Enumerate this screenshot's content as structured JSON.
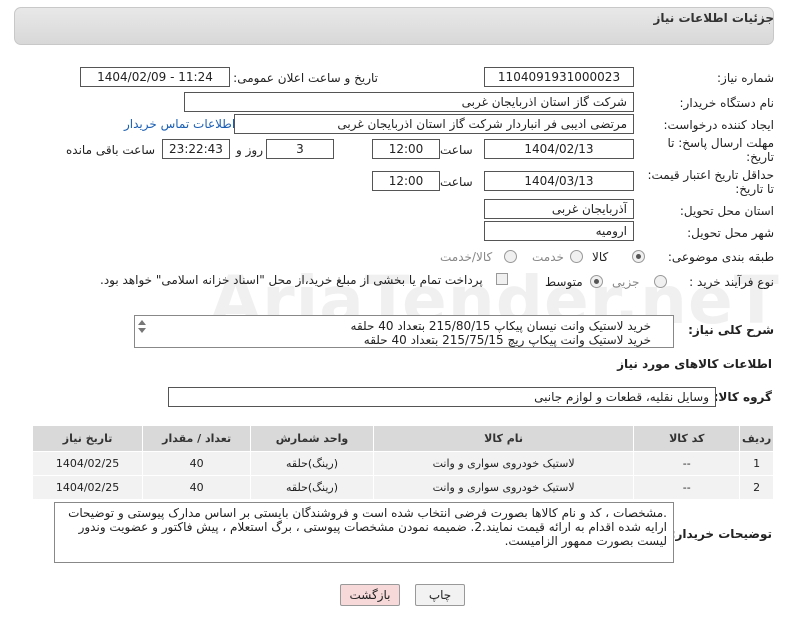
{
  "header": {
    "title": "جزئیات اطلاعات نیاز"
  },
  "fields": {
    "need_number_label": "شماره نیاز:",
    "need_number": "1104091931000023",
    "announce_label": "تاریخ و ساعت اعلان عمومی:",
    "announce_value": "1404/02/09 - 11:24",
    "buyer_org_label": "نام دستگاه خریدار:",
    "buyer_org": "شرکت گاز استان اذربایجان غربی",
    "creator_label": "ایجاد کننده درخواست:",
    "creator": "مرتضی ادیبی فر انباردار شرکت گاز استان اذربایجان غربی",
    "contact_link": "اطلاعات تماس خریدار",
    "deadline_label_1": "مهلت ارسال پاسخ: تا",
    "deadline_label_2": "تاریخ:",
    "deadline_date": "1404/02/13",
    "time_label": "ساعت",
    "deadline_time": "12:00",
    "days_value": "3",
    "days_label": "روز و",
    "remaining_time": "23:22:43",
    "remaining_label": "ساعت باقی مانده",
    "price_label_1": "حداقل تاریخ اعتبار قیمت:",
    "price_label_2": "تا تاریخ:",
    "price_date": "1404/03/13",
    "price_time": "12:00",
    "province_label": "استان محل تحویل:",
    "province": "آذربایجان غربی",
    "city_label": "شهر محل تحویل:",
    "city": "ارومیه",
    "category_label": "طبقه بندی موضوعی:",
    "category_options": [
      "کالا",
      "خدمت",
      "کالا/خدمت"
    ],
    "process_label": "نوع فرآیند خرید :",
    "process_options": [
      "جزیی",
      "متوسط"
    ],
    "payment_note": "پرداخت تمام یا بخشی از مبلغ خرید،از محل \"اسناد خزانه اسلامی\" خواهد بود.",
    "summary_label": "شرح کلی نیاز:",
    "summary_lines": [
      "خرید لاستیک وانت نیسان پیکاپ 215/80/15 بتعداد 40 حلقه",
      "خرید لاستیک وانت پیکاپ ریچ 215/75/15 بتعداد 40 حلقه"
    ],
    "goods_info_title": "اطلاعات کالاهای مورد نیاز",
    "goods_group_label": "گروه کالا:",
    "goods_group": "وسایل نقلیه، قطعات و لوازم جانبی"
  },
  "table": {
    "headers": [
      "ردیف",
      "کد کالا",
      "نام کالا",
      "واحد شمارش",
      "تعداد / مقدار",
      "تاریخ نیاز"
    ],
    "rows": [
      [
        "1",
        "--",
        "لاستیک خودروی سواری و وانت",
        "(رینگ)حلقه",
        "40",
        "1404/02/25"
      ],
      [
        "2",
        "--",
        "لاستیک خودروی سواری و وانت",
        "(رینگ)حلقه",
        "40",
        "1404/02/25"
      ]
    ]
  },
  "buyer_notes": {
    "label": "توضیحات خریدار:",
    "text": ".مشخصات ، کد و نام کالاها بصورت فرضی انتخاب شده است و فروشندگان بایستی بر اساس مدارک پیوستی و توضیحات ارایه شده اقدام به ارائه قیمت نمایند.2. ضمیمه نمودن مشخصات پیوستی ، برگ استعلام ، پیش فاکتور و عضویت وندور لیست بصورت ممهور الزامیست."
  },
  "buttons": {
    "print": "چاپ",
    "back": "بازگشت"
  },
  "watermark": "AriaTender.neT",
  "colors": {
    "link": "#1a5fb4",
    "back_button_bg": "#f7d9d9",
    "print_button_bg": "#f2f2f2",
    "header_bg": "#dcdcdc"
  }
}
